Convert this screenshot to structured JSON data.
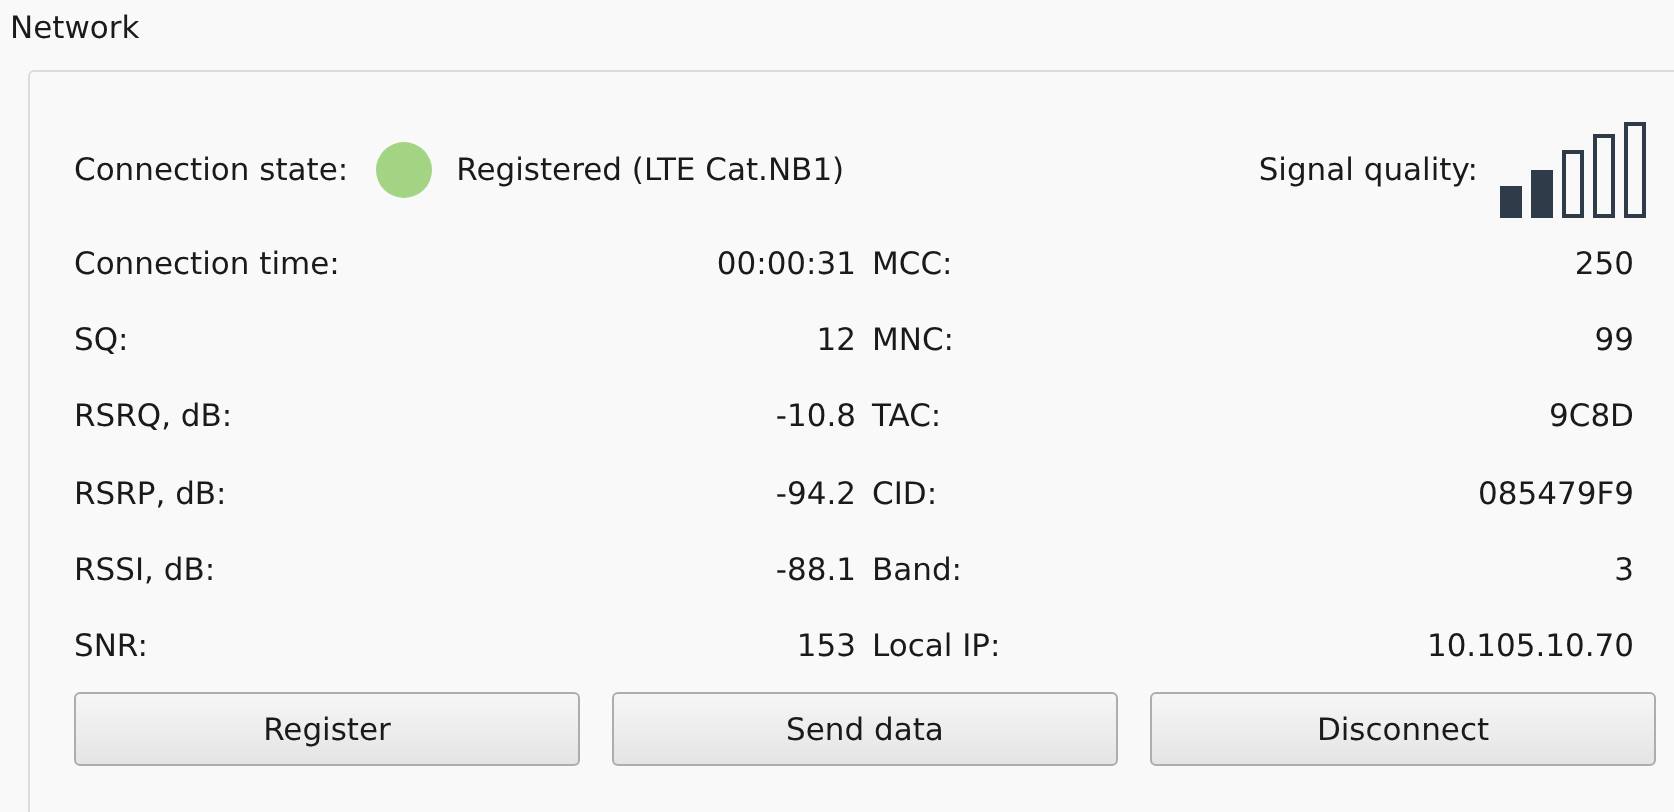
{
  "group_title": "Network",
  "connection": {
    "label": "Connection state:",
    "registered": true,
    "status": "Registered (LTE Cat.NB1)"
  },
  "signal": {
    "label": "Signal quality:"
  },
  "left_fields": [
    {
      "label": "Connection time:",
      "value": "00:00:31"
    },
    {
      "label": "SQ:",
      "value": "12"
    },
    {
      "label": "RSRQ, dB:",
      "value": "-10.8"
    },
    {
      "label": "RSRP, dB:",
      "value": "-94.2"
    },
    {
      "label": "RSSI, dB:",
      "value": "-88.1"
    },
    {
      "label": "SNR:",
      "value": "153"
    }
  ],
  "right_fields": [
    {
      "label": "MCC:",
      "value": "250"
    },
    {
      "label": "MNC:",
      "value": "99"
    },
    {
      "label": "TAC:",
      "value": "9C8D"
    },
    {
      "label": "CID:",
      "value": "085479F9"
    },
    {
      "label": "Band:",
      "value": "3"
    },
    {
      "label": "Local IP:",
      "value": "10.105.10.70"
    }
  ],
  "buttons": [
    "Register",
    "Send data",
    "Disconnect"
  ]
}
